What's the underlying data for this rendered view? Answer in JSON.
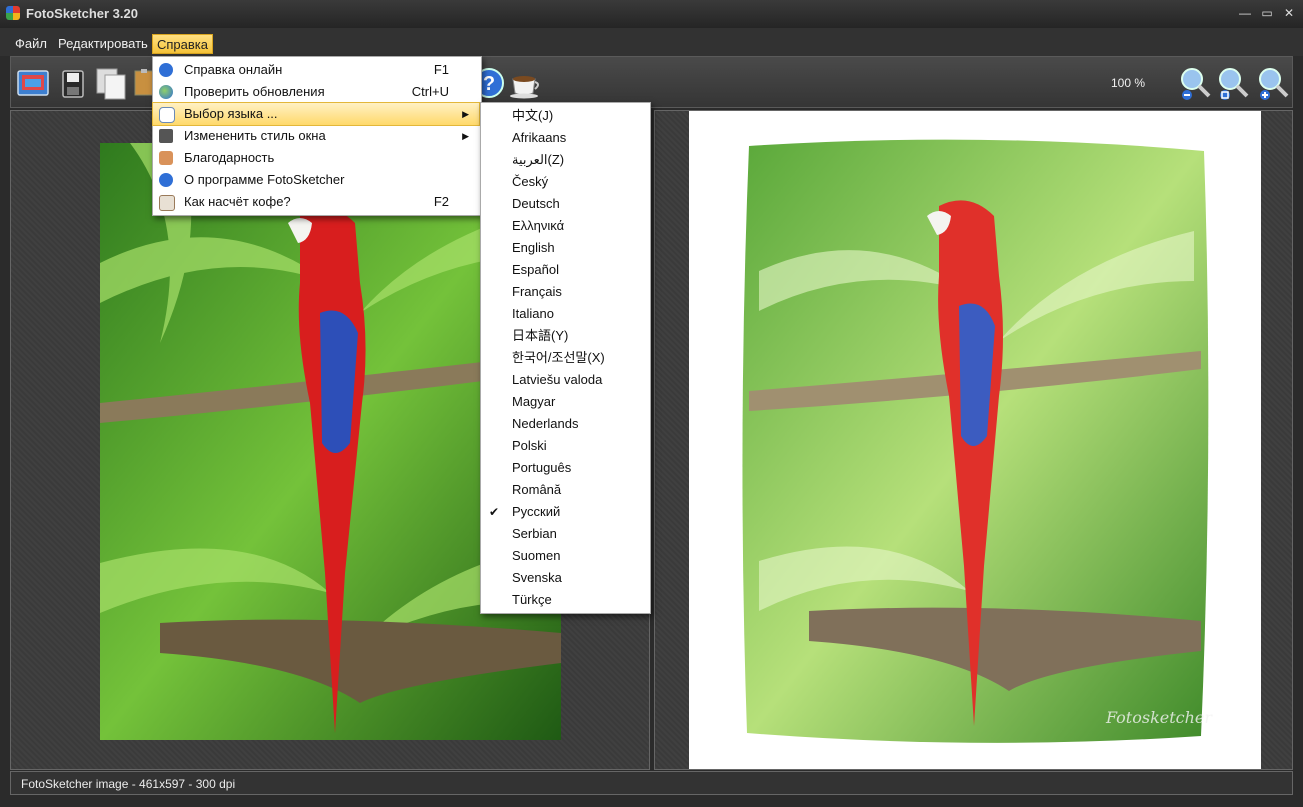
{
  "window": {
    "title": "FotoSketcher 3.20"
  },
  "menubar": {
    "file": "Файл",
    "edit": "Редактировать",
    "help": "Справка"
  },
  "toolbar": {
    "zoom": "100 %"
  },
  "help_menu": [
    {
      "label": "Справка онлайн",
      "shortcut": "F1",
      "icon": "help-icon"
    },
    {
      "label": "Проверить обновления",
      "shortcut": "Ctrl+U",
      "icon": "globe-icon"
    },
    {
      "label": "Выбор языка ...",
      "shortcut": "",
      "icon": "speech-bubble-icon"
    },
    {
      "label": "Измененить стиль окна",
      "shortcut": "",
      "icon": "window-style-icon"
    },
    {
      "label": "Благодарность",
      "shortcut": "",
      "icon": "thumbs-up-icon"
    },
    {
      "label": "О программе FotoSketcher",
      "shortcut": "",
      "icon": "info-icon"
    },
    {
      "label": "Как насчёт кофе?",
      "shortcut": "F2",
      "icon": "coffee-icon"
    }
  ],
  "language_menu": [
    "中文(J)",
    "Afrikaans",
    "العربية(Z)",
    "Český",
    "Deutsch",
    "Ελληνικά",
    "English",
    "Español",
    "Français",
    "Italiano",
    "日本語(Y)",
    "한국어/조선말(X)",
    "Latviešu valoda",
    "Magyar",
    "Nederlands",
    "Polski",
    "Português",
    "Română",
    "Русский",
    "Serbian",
    "Suomen",
    "Svenska",
    "Türkçe"
  ],
  "selected_language": "Русский",
  "status": "FotoSketcher image - 461x597 - 300 dpi",
  "colors": {
    "menu_highlight": "#f6c43a",
    "background": "#2b2b2b"
  }
}
